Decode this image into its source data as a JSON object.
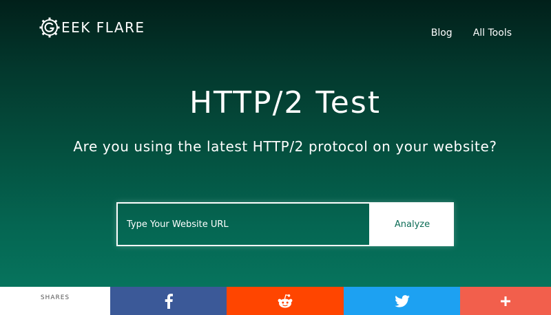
{
  "header": {
    "logo_text": "EEK FLARE",
    "nav": [
      {
        "label": "Blog"
      },
      {
        "label": "All Tools"
      }
    ]
  },
  "hero": {
    "title": "HTTP/2 Test",
    "subtitle": "Are you using the latest HTTP/2 protocol on your website?"
  },
  "form": {
    "url_placeholder": "Type Your Website URL",
    "analyze_label": "Analyze"
  },
  "share_bar": {
    "label": "SHARES",
    "buttons": [
      {
        "name": "facebook",
        "icon": "facebook-icon",
        "color": "#3b5998"
      },
      {
        "name": "reddit",
        "icon": "reddit-icon",
        "color": "#ff4500"
      },
      {
        "name": "twitter",
        "icon": "twitter-icon",
        "color": "#1da1f2"
      },
      {
        "name": "more",
        "icon": "plus-icon",
        "color": "#f25f4c"
      }
    ]
  }
}
